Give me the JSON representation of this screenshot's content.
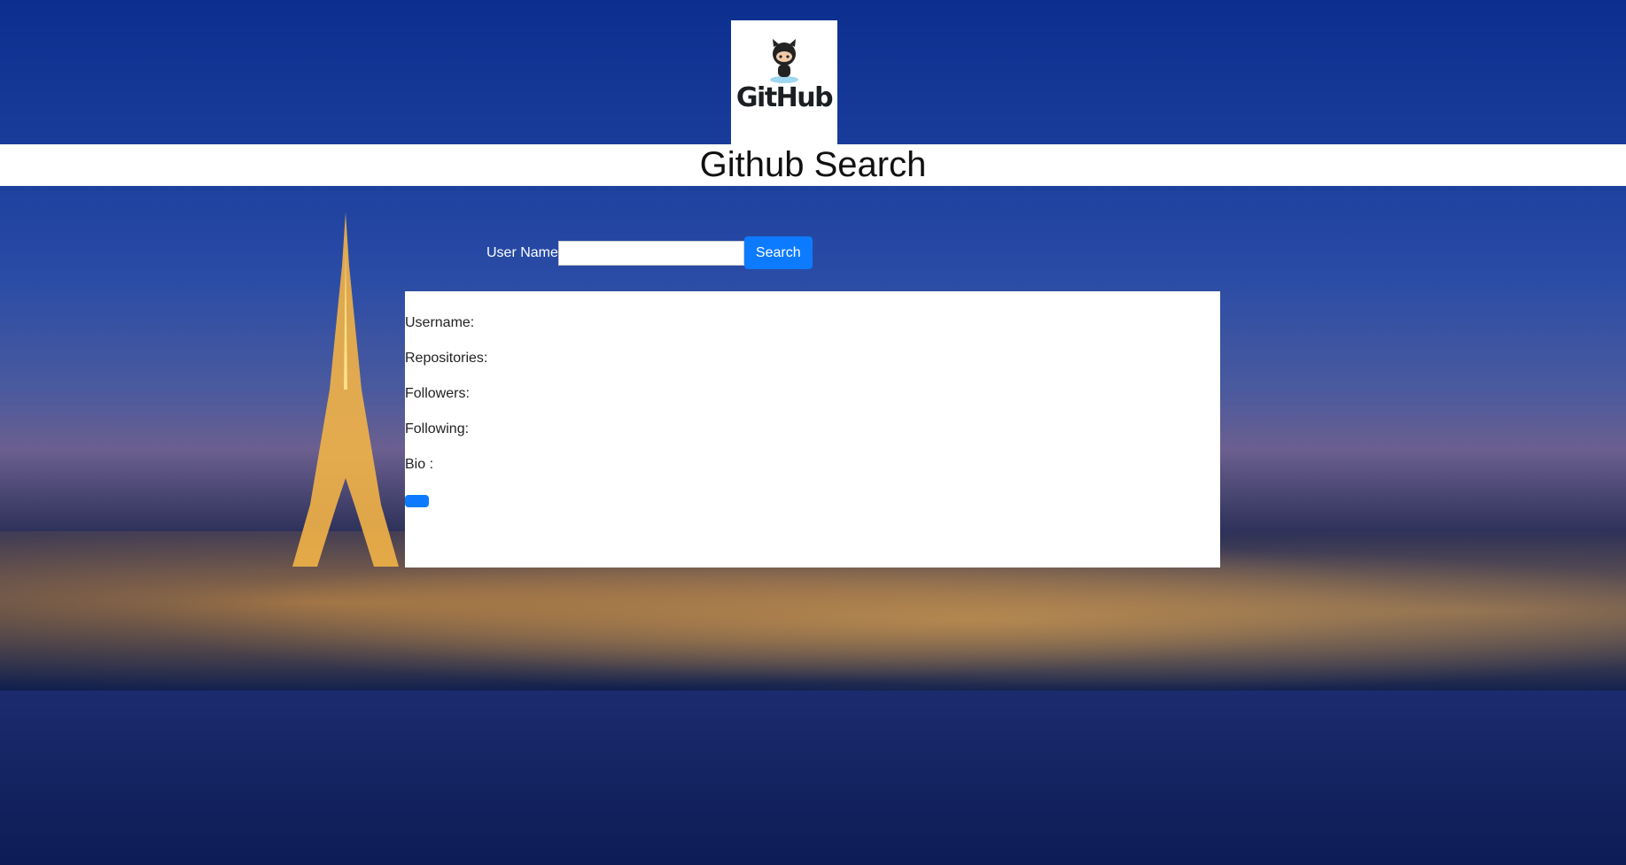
{
  "logo": {
    "text": "GitHub",
    "icon": "octocat-icon"
  },
  "header": {
    "title": "Github Search"
  },
  "search": {
    "label": "User Name",
    "value": "",
    "placeholder": "",
    "button_label": "Search"
  },
  "results": {
    "username_label": "Username:",
    "repositories_label": "Repositories:",
    "followers_label": "Followers:",
    "following_label": "Following:",
    "bio_label": "Bio :",
    "action_button_label": ""
  },
  "colors": {
    "accent": "#0d7bff",
    "sky": "#0c2f8f"
  }
}
